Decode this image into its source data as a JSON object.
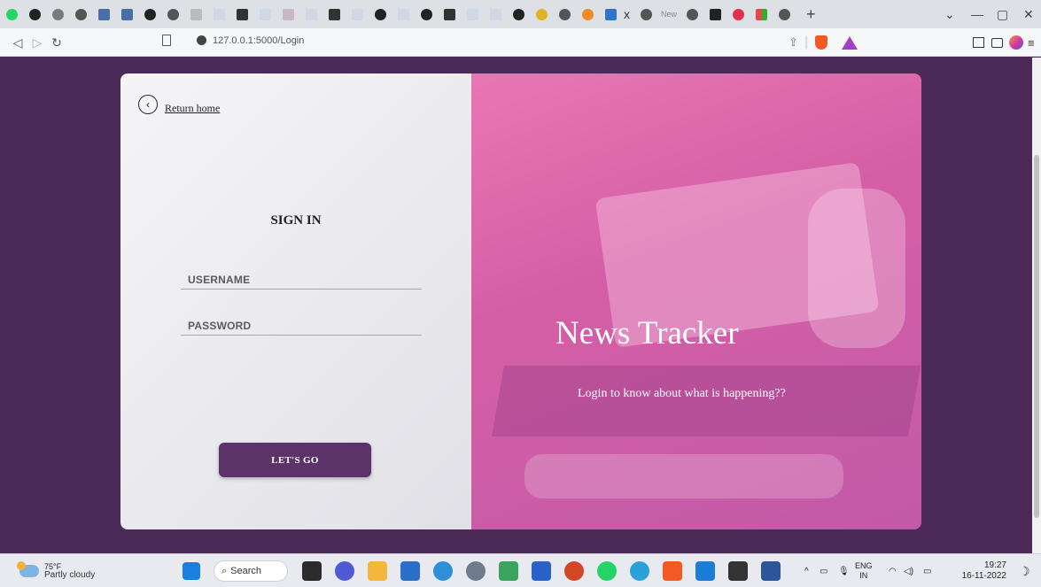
{
  "browser": {
    "tab_title": "New",
    "tab_close": "x",
    "new_tab": "+",
    "url": "127.0.0.1:5000/Login"
  },
  "page": {
    "return_label": "Return home",
    "signin_heading": "SIGN IN",
    "username_placeholder": "USERNAME",
    "password_placeholder": "PASSWORD",
    "submit_label": "LET'S GO",
    "brand_title": "News Tracker",
    "brand_subtitle": "Login to know about what is happening??"
  },
  "taskbar": {
    "temperature": "75°F",
    "weather": "Partly cloudy",
    "search_label": "Search",
    "lang_top": "ENG",
    "lang_bottom": "IN",
    "time": "19:27",
    "date": "16-11-2022"
  },
  "colors": {
    "page_bg": "#4b2a57",
    "button": "#5b3369",
    "brand_pink": "#e06aae"
  }
}
